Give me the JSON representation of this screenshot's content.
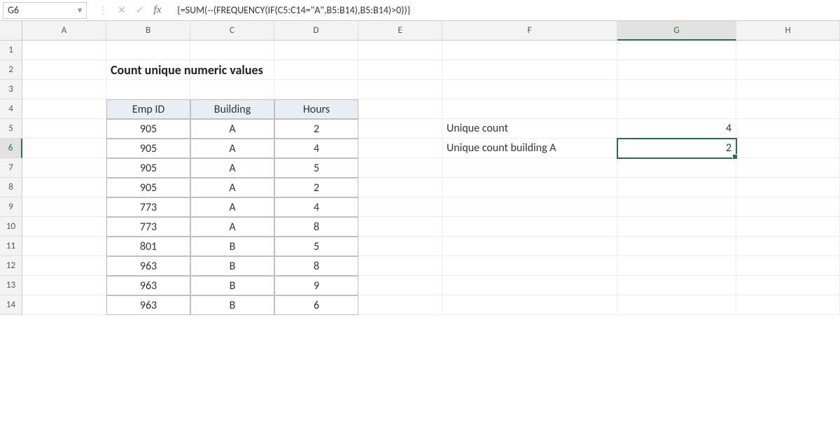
{
  "namebox": "G6",
  "formula": "{=SUM(--(FREQUENCY(IF(C5:C14=\"A\",B5:B14),B5:B14)>0))}",
  "columns": [
    "A",
    "B",
    "C",
    "D",
    "E",
    "F",
    "G",
    "H"
  ],
  "rowCount": 14,
  "selectedCell": "G6",
  "selectedCol": "G",
  "selectedRow": "6",
  "title": "Count unique numeric values",
  "table": {
    "headers": [
      "Emp ID",
      "Building",
      "Hours"
    ],
    "rows": [
      [
        "905",
        "A",
        "2"
      ],
      [
        "905",
        "A",
        "4"
      ],
      [
        "905",
        "A",
        "5"
      ],
      [
        "905",
        "A",
        "2"
      ],
      [
        "773",
        "A",
        "4"
      ],
      [
        "773",
        "A",
        "8"
      ],
      [
        "801",
        "B",
        "5"
      ],
      [
        "963",
        "B",
        "8"
      ],
      [
        "963",
        "B",
        "9"
      ],
      [
        "963",
        "B",
        "6"
      ]
    ]
  },
  "labels": {
    "uniqueCount": "Unique count",
    "uniqueCountA": "Unique count building A"
  },
  "values": {
    "uniqueCount": "4",
    "uniqueCountA": "2"
  }
}
